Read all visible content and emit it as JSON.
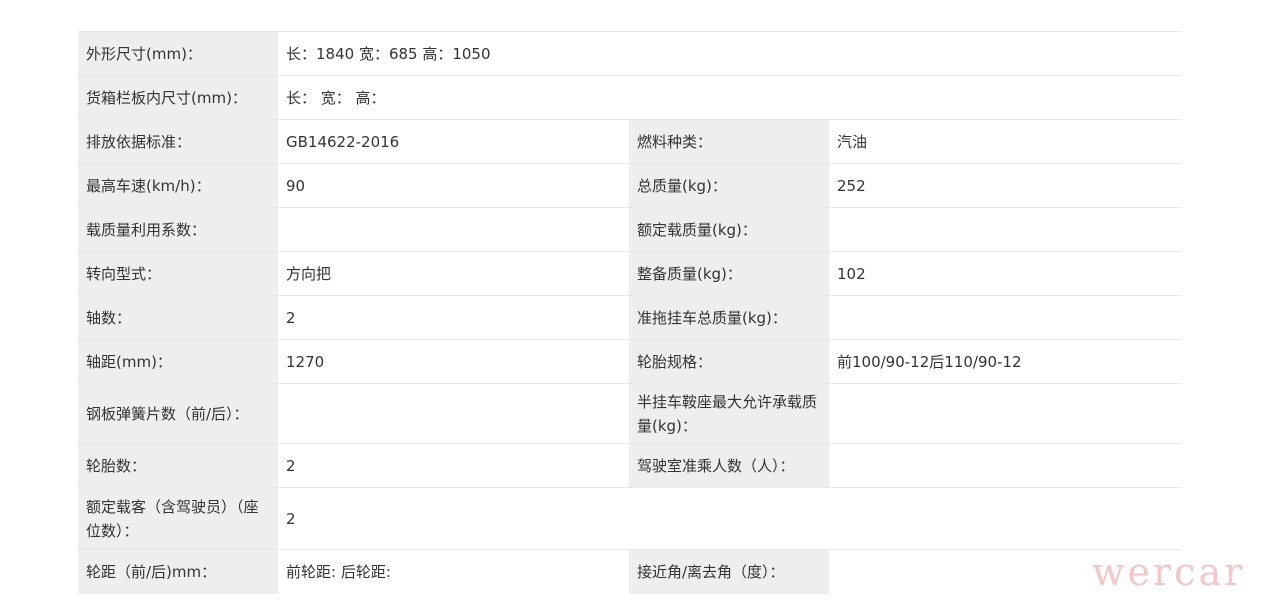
{
  "rows": [
    {
      "l1": "外形尺寸(mm)：",
      "v1": "长：1840 宽：685 高：1050"
    },
    {
      "l1": "货箱栏板内尺寸(mm)：",
      "v1": "长： 宽： 高："
    },
    {
      "l1": "排放依据标准：",
      "v1": "GB14622-2016",
      "l2": "燃料种类：",
      "v2": "汽油"
    },
    {
      "l1": "最高车速(km/h)：",
      "v1": "90",
      "l2": "总质量(kg)：",
      "v2": "252"
    },
    {
      "l1": "载质量利用系数：",
      "v1": "",
      "l2": "额定载质量(kg)：",
      "v2": ""
    },
    {
      "l1": "转向型式：",
      "v1": "方向把",
      "l2": "整备质量(kg)：",
      "v2": "102"
    },
    {
      "l1": "轴数：",
      "v1": "2",
      "l2": "准拖挂车总质量(kg)：",
      "v2": ""
    },
    {
      "l1": "轴距(mm)：",
      "v1": "1270",
      "l2": "轮胎规格：",
      "v2": "前100/90-12后110/90-12"
    },
    {
      "l1": "钢板弹簧片数（前/后）：",
      "v1": "",
      "l2": "半挂车鞍座最大允许承载质量(kg)：",
      "v2": ""
    },
    {
      "l1": "轮胎数：",
      "v1": "2",
      "l2": "驾驶室准乘人数（人）：",
      "v2": ""
    },
    {
      "l1": "额定载客（含驾驶员）（座位数）：",
      "v1": "2"
    },
    {
      "l1": "轮距（前/后)mm：",
      "v1": "前轮距: 后轮距:",
      "l2": "接近角/离去角（度）：",
      "v2": ""
    }
  ],
  "watermark": "wercar"
}
